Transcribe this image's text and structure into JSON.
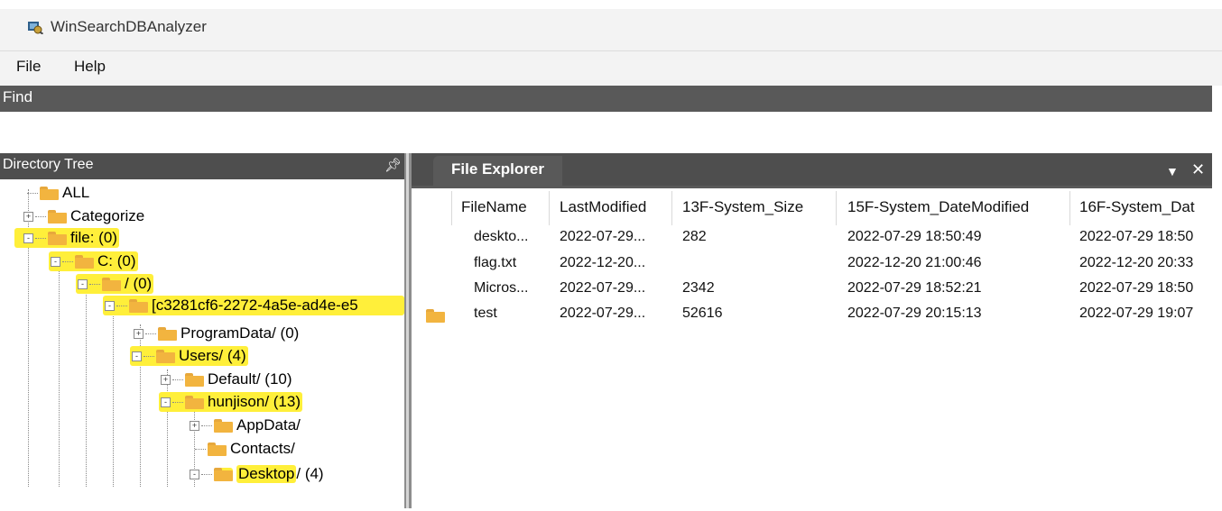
{
  "app": {
    "title": "WinSearchDBAnalyzer"
  },
  "menu": [
    "File",
    "Help"
  ],
  "find_bar": {
    "label": "Find"
  },
  "tree": {
    "header": "Directory Tree",
    "pin_icon": "pin-icon",
    "nodes": [
      {
        "label": "ALL",
        "toggle": "",
        "highlight": false
      },
      {
        "label": "Categorize",
        "toggle": "+",
        "highlight": false
      },
      {
        "label": "file: (0)",
        "toggle": "-",
        "highlight": true
      },
      {
        "label": "C: (0)",
        "toggle": "-",
        "highlight": true
      },
      {
        "label": "/ (0)",
        "toggle": "-",
        "highlight": true
      },
      {
        "label": "[c3281cf6-2272-4a5e-ad4e-e5",
        "toggle": "-",
        "highlight": true
      },
      {
        "label": "ProgramData/ (0)",
        "toggle": "+",
        "highlight": false
      },
      {
        "label": "Users/ (4)",
        "toggle": "-",
        "highlight": true
      },
      {
        "label": "Default/ (10)",
        "toggle": "+",
        "highlight": false
      },
      {
        "label": "hunjison/ (13)",
        "toggle": "-",
        "highlight": true
      },
      {
        "label": "AppData/",
        "toggle": "+",
        "highlight": false
      },
      {
        "label": "Contacts/",
        "toggle": "",
        "highlight": false
      },
      {
        "label": "Desktop",
        "label_suffix": "/ (4)",
        "toggle": "-",
        "highlight": true
      }
    ]
  },
  "file_explorer": {
    "tab_label": "File Explorer",
    "columns": [
      "FileName",
      "LastModified",
      "13F-System_Size",
      "15F-System_DateModified",
      "16F-System_Dat"
    ],
    "rows": [
      {
        "icon": "",
        "cells": [
          "deskto...",
          "2022-07-29...",
          "282",
          "2022-07-29 18:50:49",
          "2022-07-29 18:50"
        ]
      },
      {
        "icon": "",
        "cells": [
          "flag.txt",
          "2022-12-20...",
          "",
          "2022-12-20 21:00:46",
          "2022-12-20 20:33"
        ]
      },
      {
        "icon": "",
        "cells": [
          "Micros...",
          "2022-07-29...",
          "2342",
          "2022-07-29 18:52:21",
          "2022-07-29 18:50"
        ]
      },
      {
        "icon": "folder-icon",
        "cells": [
          "test",
          "2022-07-29...",
          "52616",
          "2022-07-29 20:15:13",
          "2022-07-29 19:07"
        ]
      }
    ]
  },
  "colors": {
    "highlight": "#ffef3a",
    "folder": "#f2b43f",
    "header_bar": "#4e4e4e",
    "find_bar": "#595959"
  }
}
